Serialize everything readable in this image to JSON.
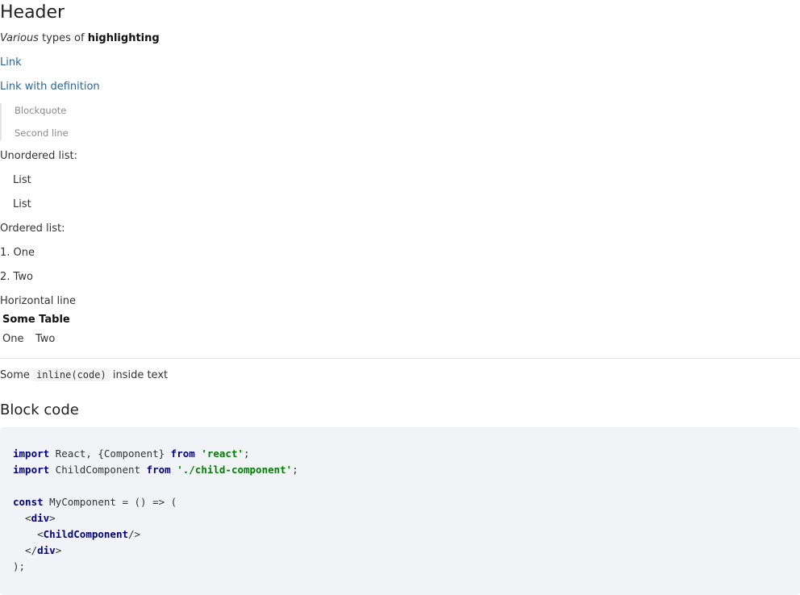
{
  "header": "Header",
  "emphasis_line": {
    "italic": "Various",
    "middle": " types of ",
    "bold": "highlighting"
  },
  "links": {
    "link": "Link",
    "link_with_definition": "Link with definition"
  },
  "blockquote": [
    "Blockquote",
    "Second line"
  ],
  "unordered": {
    "label": "Unordered list:",
    "items": [
      "List",
      "List"
    ]
  },
  "ordered": {
    "label": "Ordered list:",
    "items": [
      "1. One",
      "2. Two"
    ]
  },
  "horizontal_line_label": "Horizontal line",
  "table": {
    "title": "Some Table",
    "cells": [
      "One",
      "Two"
    ]
  },
  "inline_code_line": {
    "before": "Some ",
    "code": "inline(code)",
    "after": " inside text"
  },
  "block_code_heading": "Block code",
  "code": {
    "l1_kw": "import",
    "l1_rest": " React, {Component} ",
    "l1_kw2": "from",
    "l1_sp": " ",
    "l1_str": "'react'",
    "l1_end": ";",
    "l2_kw": "import",
    "l2_rest": " ChildComponent ",
    "l2_kw2": "from",
    "l2_sp": " ",
    "l2_str": "'./child-component'",
    "l2_end": ";",
    "l4_kw": "const",
    "l4_rest": " MyComponent = () => (",
    "l5_open": "  <",
    "l5_tag": "div",
    "l5_close": ">",
    "l6_open": "    <",
    "l6_tag": "ChildComponent",
    "l6_close": "/>",
    "l7_open": "  </",
    "l7_tag": "div",
    "l7_close": ">",
    "l8": ");"
  }
}
